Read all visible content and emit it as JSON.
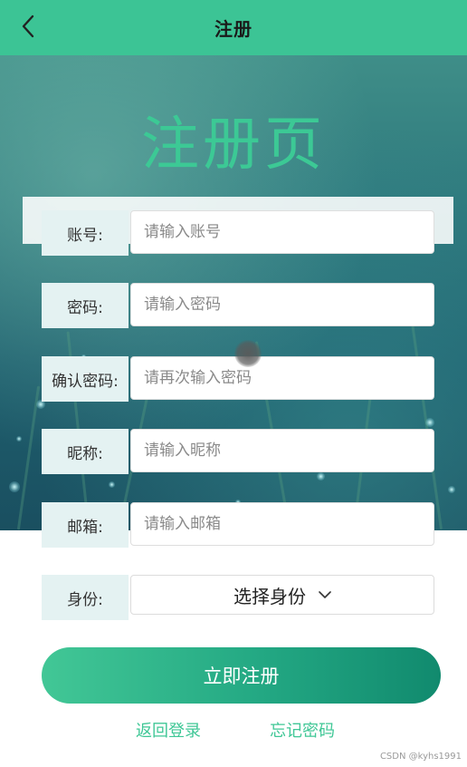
{
  "header": {
    "title": "注册"
  },
  "page_heading": "注册页",
  "fields": [
    {
      "label": "账号:",
      "placeholder": "请输入账号"
    },
    {
      "label": "密码:",
      "placeholder": "请输入密码"
    },
    {
      "label": "确认密码:",
      "placeholder": "请再次输入密码"
    },
    {
      "label": "昵称:",
      "placeholder": "请输入昵称"
    },
    {
      "label": "邮箱:",
      "placeholder": "请输入邮箱"
    }
  ],
  "identity": {
    "label": "身份:",
    "selected": "选择身份"
  },
  "submit_label": "立即注册",
  "links": {
    "back_login": "返回登录",
    "forgot_password": "忘记密码"
  },
  "watermark": "CSDN @kyhs1991",
  "colors": {
    "accent": "#3cc495",
    "label_bg": "#e4f2f2"
  }
}
